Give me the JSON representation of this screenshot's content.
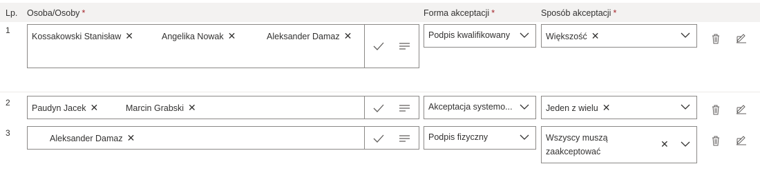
{
  "header": {
    "lp": "Lp.",
    "persons": "Osoba/Osoby",
    "form": "Forma akceptacji",
    "method": "Sposób akceptacji",
    "required_mark": "*"
  },
  "rows": [
    {
      "num": "1",
      "persons": [
        "Kossakowski Stanisław",
        "Angelika Nowak",
        "Aleksander Damaz"
      ],
      "form": "Podpis kwalifikowany",
      "method": "Większość"
    },
    {
      "num": "2",
      "persons": [
        "Paudyn Jacek",
        "Marcin Grabski"
      ],
      "form": "Akceptacja systemo...",
      "method": "Jeden z wielu"
    },
    {
      "num": "3",
      "persons": [
        "Aleksander Damaz"
      ],
      "form": "Podpis fizyczny",
      "method_line1": "Wszyscy muszą",
      "method_line2": "zaakceptować"
    }
  ],
  "icons": {
    "remove": "close-icon",
    "confirm": "checkmark-icon",
    "details": "lines-icon",
    "dropdown": "chevron-down-icon",
    "delete": "trash-icon",
    "edit": "edit-icon"
  },
  "colors": {
    "required": "#a4262c",
    "header_bg": "#f3f2f1",
    "border": "#8a8886"
  }
}
